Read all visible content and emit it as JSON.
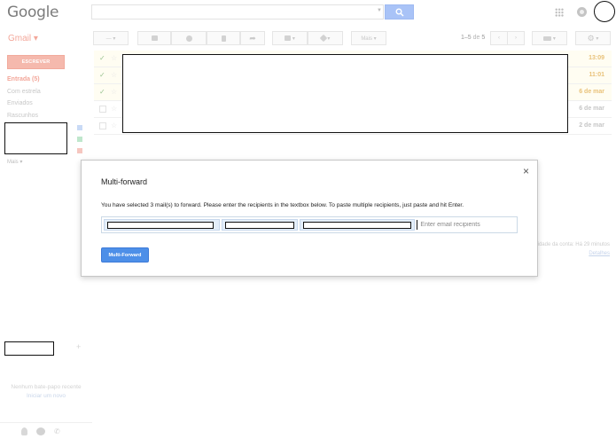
{
  "header": {
    "logo_text": "Google",
    "search": {
      "value": "",
      "placeholder": ""
    },
    "icons": [
      "search-icon",
      "apps-grid-icon",
      "notifications-icon",
      "avatar"
    ]
  },
  "toolbar": {
    "app_label": "Gmail ▾",
    "more_label": "Mais ▾",
    "page_range": "1–5",
    "page_of": "de",
    "page_total": "5"
  },
  "sidebar": {
    "compose_label": "ESCREVER",
    "items": [
      {
        "label": "Entrada (5)",
        "active": true
      },
      {
        "label": "Com estrela",
        "active": false
      },
      {
        "label": "Enviados",
        "active": false
      },
      {
        "label": "Rascunhos",
        "active": false
      }
    ],
    "more_label": "Mais ▾",
    "chat_empty_line1": "Nenhum bate-papo recente",
    "chat_empty_line2": "Iniciar um novo"
  },
  "mail_list": [
    {
      "time": "13:09",
      "checked": true,
      "unread": true
    },
    {
      "time": "11:01",
      "checked": true,
      "unread": true
    },
    {
      "time": "6 de mar",
      "checked": true,
      "unread": true
    },
    {
      "time": "6 de mar",
      "checked": false,
      "unread": false
    },
    {
      "time": "2 de mar",
      "checked": false,
      "unread": false
    }
  ],
  "footer": {
    "activity_text": "idade da conta: Há 29 minutos",
    "details_link": "Detalhes"
  },
  "dialog": {
    "title": "Multi-forward",
    "message": "You have selected 3 mail(s) to forward. Please enter the recipients in the textbox below. To paste multiple recipients, just paste and hit Enter.",
    "recipient_placeholder": "Enter email recipients",
    "recipient_value": "",
    "chip_count": 3,
    "submit_label": "Multi-Forward",
    "close_label": "×"
  },
  "colors": {
    "accent_blue": "#4d8fe8",
    "gmail_red_dimmed": "#f3a79a",
    "compose_red_dimmed": "#f5b9ad",
    "chip_bg": "#e3eefa"
  }
}
